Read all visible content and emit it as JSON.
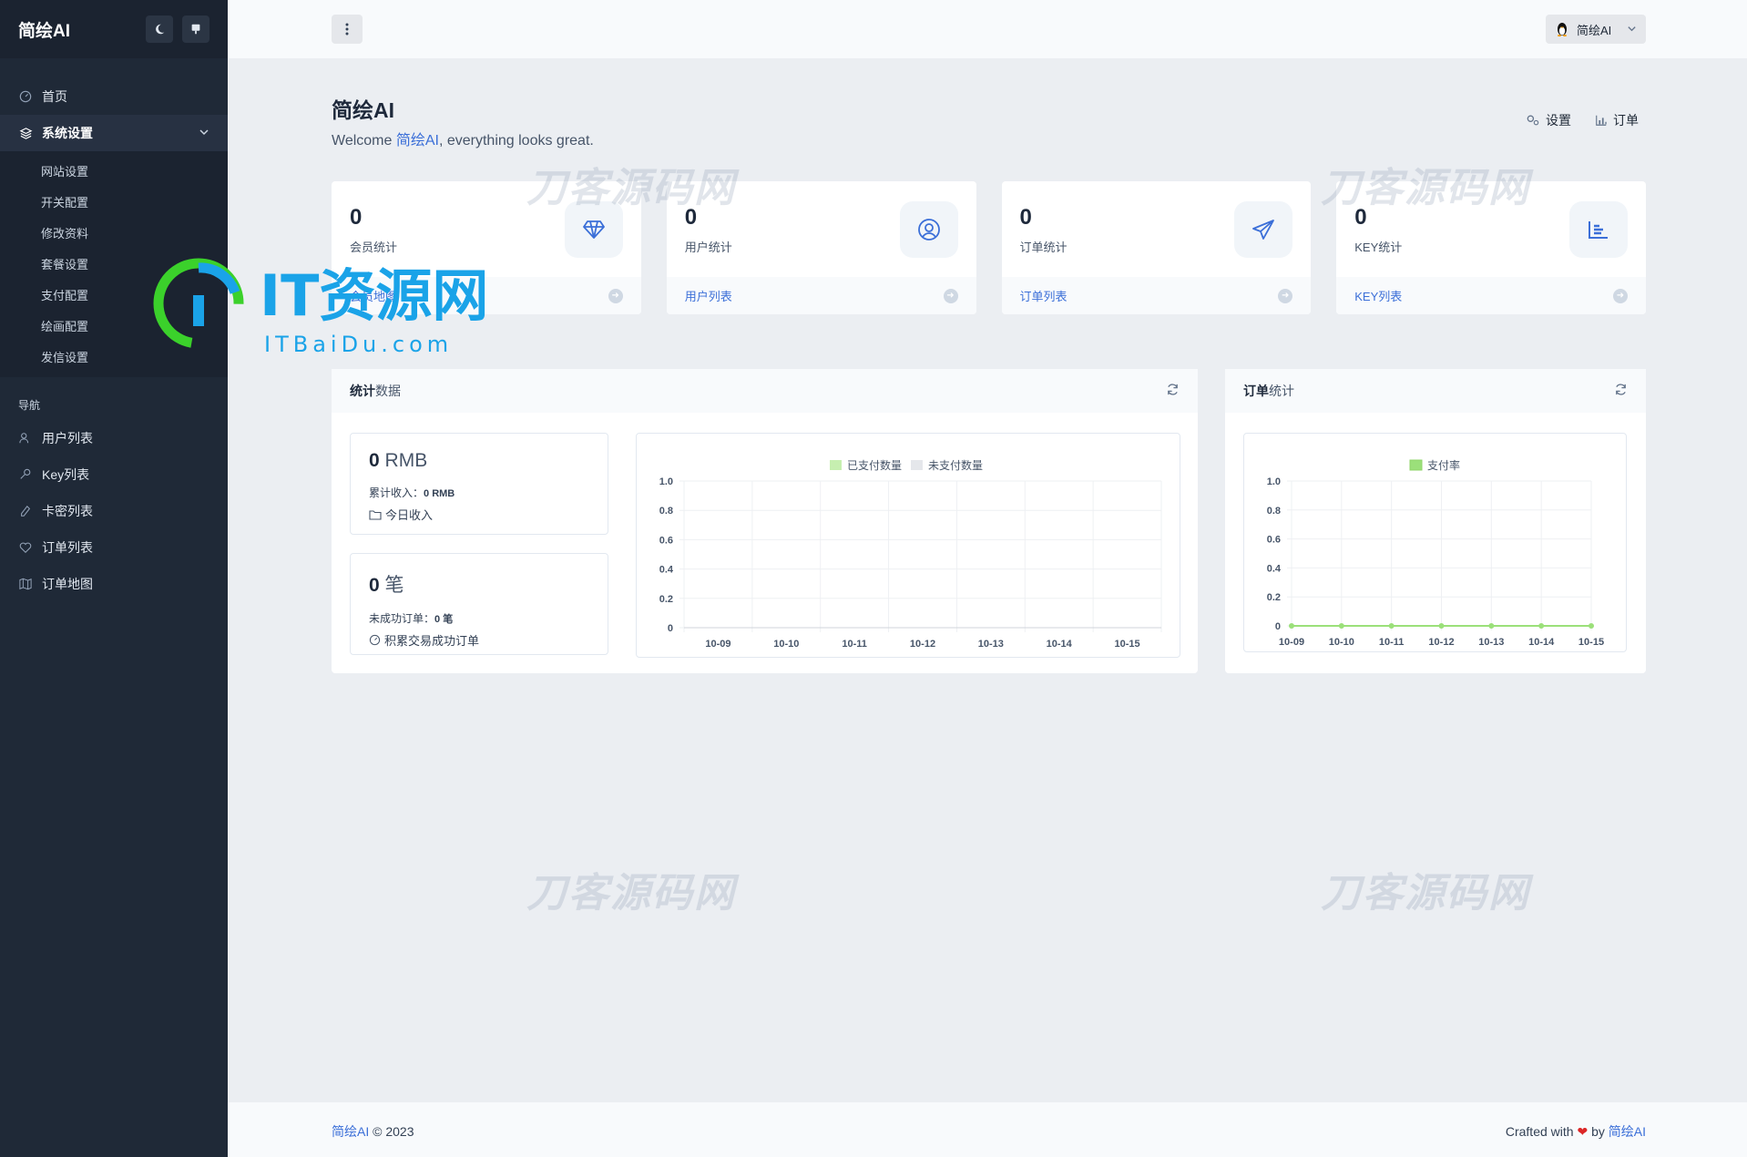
{
  "sidebar": {
    "brand": "简绘AI",
    "home": "首页",
    "system_settings": "系统设置",
    "sub_items": [
      "网站设置",
      "开关配置",
      "修改资料",
      "套餐设置",
      "支付配置",
      "绘画配置",
      "发信设置"
    ],
    "nav_heading": "导航",
    "nav_items": [
      {
        "label": "用户列表",
        "icon": "users-icon"
      },
      {
        "label": "Key列表",
        "icon": "key-icon"
      },
      {
        "label": "卡密列表",
        "icon": "pen-icon"
      },
      {
        "label": "订单列表",
        "icon": "heart-icon"
      },
      {
        "label": "订单地图",
        "icon": "map-icon"
      }
    ]
  },
  "topbar": {
    "user_name": "简绘AI"
  },
  "page": {
    "title": "简绘AI",
    "welcome_prefix": "Welcome ",
    "welcome_name": "简绘AI",
    "welcome_suffix": ", everything looks great.",
    "action_settings": "设置",
    "action_orders": "订单"
  },
  "stats": [
    {
      "value": "0",
      "label": "会员统计",
      "link": "会员地图"
    },
    {
      "value": "0",
      "label": "用户统计",
      "link": "用户列表"
    },
    {
      "value": "0",
      "label": "订单统计",
      "link": "订单列表"
    },
    {
      "value": "0",
      "label": "KEY统计",
      "link": "KEY列表"
    }
  ],
  "stats_panel": {
    "title_bold": "统计",
    "title_rest": "数据",
    "revenue_value": "0",
    "revenue_unit": "RMB",
    "revenue_total_label": "累计收入：",
    "revenue_total_value": "0 RMB",
    "revenue_today": "今日收入",
    "orders_value": "0",
    "orders_unit": "笔",
    "failed_label": "未成功订单：",
    "failed_value": "0 笔",
    "success_label": "积累交易成功订单"
  },
  "order_panel": {
    "title_bold": "订单",
    "title_rest": "统计"
  },
  "chart_data": [
    {
      "type": "bar",
      "categories": [
        "10-09",
        "10-10",
        "10-11",
        "10-12",
        "10-13",
        "10-14",
        "10-15"
      ],
      "series": [
        {
          "name": "已支付数量",
          "values": [
            0,
            0,
            0,
            0,
            0,
            0,
            0
          ],
          "color": "#c6efb0"
        },
        {
          "name": "未支付数量",
          "values": [
            0,
            0,
            0,
            0,
            0,
            0,
            0
          ],
          "color": "#e5e7eb"
        }
      ],
      "ylim": [
        0,
        1.0
      ],
      "yticks": [
        "0",
        "0.2",
        "0.4",
        "0.6",
        "0.8",
        "1.0"
      ],
      "grid": true,
      "legend": "top"
    },
    {
      "type": "line",
      "categories": [
        "10-09",
        "10-10",
        "10-11",
        "10-12",
        "10-13",
        "10-14",
        "10-15"
      ],
      "series": [
        {
          "name": "支付率",
          "values": [
            0,
            0,
            0,
            0,
            0,
            0,
            0
          ],
          "color": "#9be07a"
        }
      ],
      "ylim": [
        0,
        1.0
      ],
      "yticks": [
        "0",
        "0.2",
        "0.4",
        "0.6",
        "0.8",
        "1.0"
      ],
      "grid": true,
      "legend": "top"
    }
  ],
  "footer": {
    "left_name": "简绘AI",
    "left_copy": " © 2023",
    "right_prefix": "Crafted with ",
    "right_by": " by ",
    "right_name": "简绘AI"
  },
  "watermarks": [
    "刀客源码网",
    "IT资源网",
    "ITBaiDu.com"
  ]
}
